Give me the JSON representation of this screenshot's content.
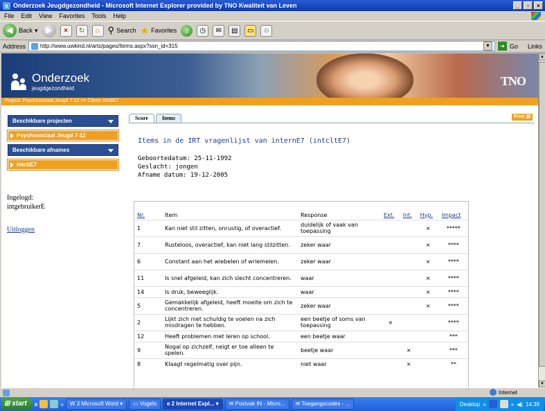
{
  "window": {
    "title": "Onderzoek Jeugdgezondheid - Microsoft Internet Explorer provided by TNO Kwaliteit van Leven"
  },
  "menu": [
    "File",
    "Edit",
    "View",
    "Favorites",
    "Tools",
    "Help"
  ],
  "toolbar": {
    "back": "Back",
    "search": "Search",
    "favorites": "Favorites"
  },
  "address": {
    "label": "Address",
    "url": "http://www.uwkind.nl/arts/pages/Items.aspx?ssn_id=315",
    "go": "Go",
    "links": "Links"
  },
  "header": {
    "title": "Onderzoek",
    "subtitle": "jeugdgezondheid",
    "brand": "TNO"
  },
  "breadcrumb": "Project: Psychosociaal Jeugd 7-12 >> Client: intcltE7",
  "sidebar": {
    "projects_label": "Beschikbare projecten",
    "project_selected": "Psychosociaal Jeugd 7-12",
    "afnames_label": "Beschikbare afnames",
    "afname_selected": "intcltE7",
    "logged_in_label": "Ingelogd:",
    "user": "intgebruikerE",
    "logout": "Uitloggen"
  },
  "tabs": [
    {
      "label": "Score"
    },
    {
      "label": "Items"
    }
  ],
  "print_label": "Print",
  "content": {
    "title": "Items in de IRT vragenlijst van internE7 (intcltE7)",
    "birth": "Geboortedatum: 25-11-1992",
    "gender": "Geslacht: jongen",
    "date": "Afname datum: 19-12-2005"
  },
  "table": {
    "headers": {
      "nr": "Nr.",
      "item": "Item",
      "response": "Response",
      "ext": "Ext.",
      "int": "Int.",
      "hyp": "Hyp.",
      "impact": "Impact"
    },
    "rows": [
      {
        "nr": "1",
        "item": "Kan niet stil zitten, onrustig, of overactief.",
        "response": "duidelijk of vaak van toepassing",
        "ext": "",
        "int": "",
        "hyp": "×",
        "impact": "*****"
      },
      {
        "nr": "7",
        "item": "Rusteloos, overactief, kan niet lang stilzitten.",
        "response": "zeker waar",
        "ext": "",
        "int": "",
        "hyp": "×",
        "impact": "****"
      },
      {
        "nr": "6",
        "item": "Constant aan het wiebelen of wriemelen.",
        "response": "zeker waar",
        "ext": "",
        "int": "",
        "hyp": "×",
        "impact": "****"
      },
      {
        "nr": "11",
        "item": "Is snel afgeleid, kan zich slecht concentreren.",
        "response": "waar",
        "ext": "",
        "int": "",
        "hyp": "×",
        "impact": "****"
      },
      {
        "nr": "14",
        "item": "Is druk, beweeglijk.",
        "response": "waar",
        "ext": "",
        "int": "",
        "hyp": "×",
        "impact": "****"
      },
      {
        "nr": "5",
        "item": "Gemakkelijk afgeleid, heeft moeite om zich te concentreren.",
        "response": "zeker waar",
        "ext": "",
        "int": "",
        "hyp": "×",
        "impact": "****"
      },
      {
        "nr": "2",
        "item": "Lijkt zich niet schuldig te voelen na zich misdragen te hebben.",
        "response": "een beetje of soms van toepassing",
        "ext": "×",
        "int": "",
        "hyp": "",
        "impact": "****"
      },
      {
        "nr": "12",
        "item": "Heeft problemen met leren op school.",
        "response": "een beetje waar",
        "ext": "",
        "int": "",
        "hyp": "",
        "impact": "***"
      },
      {
        "nr": "9",
        "item": "Nogal op zichzelf, neigt er toe alleen te spelen.",
        "response": "beetje waar",
        "ext": "",
        "int": "×",
        "hyp": "",
        "impact": "***"
      },
      {
        "nr": "8",
        "item": "Klaagt regelmatig over pijn.",
        "response": "niet waar",
        "ext": "",
        "int": "×",
        "hyp": "",
        "impact": "**"
      }
    ]
  },
  "status": {
    "zone": "Internet"
  },
  "taskbar": {
    "start": "start",
    "tasks": [
      "3 Microsoft Word",
      "Vogels",
      "2 Internet Expl...",
      "Postvak IN - Micro...",
      "Toegangscodes - ...",
      "Desktop"
    ],
    "clock": "14:39"
  }
}
